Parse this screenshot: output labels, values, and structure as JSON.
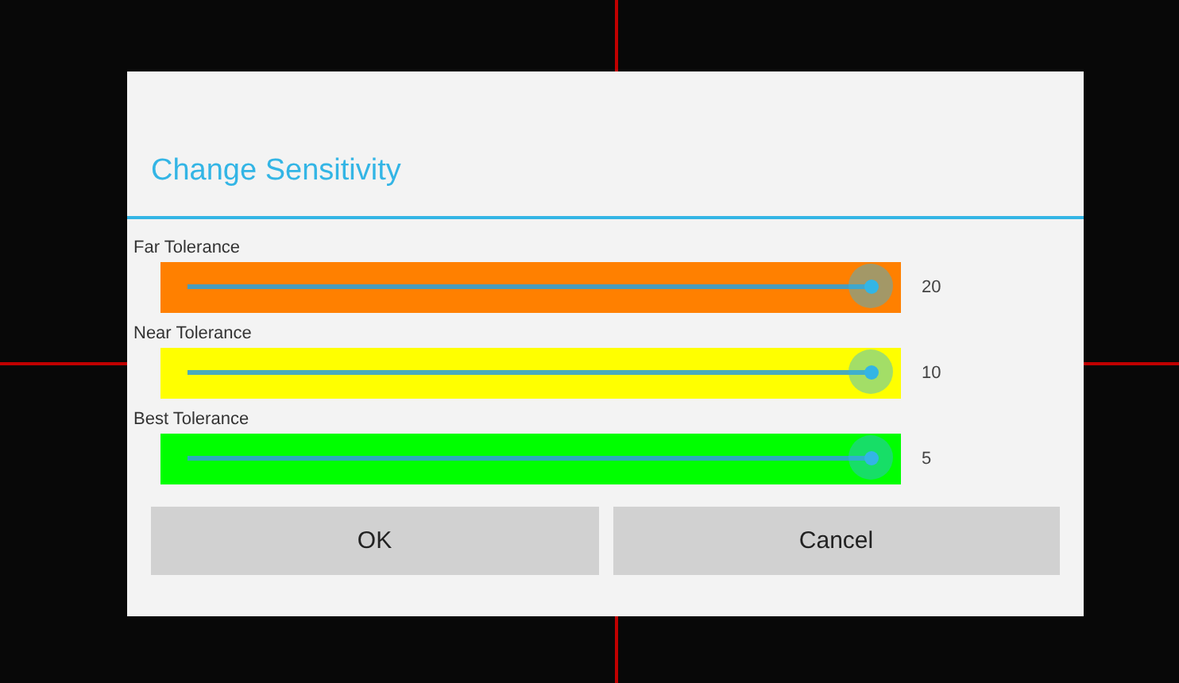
{
  "dialog": {
    "title": "Change Sensitivity",
    "sliders": [
      {
        "label": "Far Tolerance",
        "color": "#ff8000",
        "level": 1,
        "reading": "20"
      },
      {
        "label": "Near Tolerance",
        "color": "#ffff00",
        "level": 1,
        "reading": "10"
      },
      {
        "label": "Best Tolerance",
        "color": "#00ff00",
        "level": 1,
        "reading": "5"
      }
    ],
    "buttons": [
      "OK",
      "Cancel"
    ]
  }
}
